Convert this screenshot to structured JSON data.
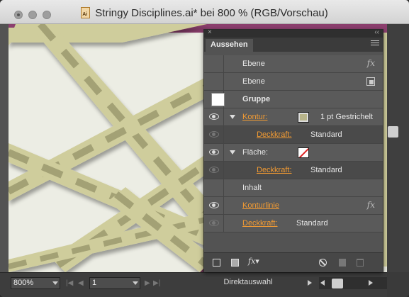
{
  "window": {
    "title": "Stringy Disciplines.ai* bei 800 % (RGB/Vorschau)",
    "file_icon_label": "Ai"
  },
  "panel": {
    "tab": "Aussehen",
    "rows": [
      {
        "id": "ebene1",
        "label": "Ebene",
        "icon": "fx-icon"
      },
      {
        "id": "ebene2",
        "label": "Ebene",
        "icon": "layer-target-icon"
      },
      {
        "id": "gruppe",
        "label": "Gruppe"
      },
      {
        "id": "kontur",
        "label": "Kontur:",
        "value": "1 pt Gestrichelt",
        "swatch": "#b8b48a"
      },
      {
        "id": "kontur-deckkraft",
        "label": "Deckkraft:",
        "value": "Standard"
      },
      {
        "id": "flaeche",
        "label": "Fläche:",
        "swatch": "none"
      },
      {
        "id": "flaeche-deckkraft",
        "label": "Deckkraft:",
        "value": "Standard"
      },
      {
        "id": "inhalt",
        "label": "Inhalt"
      },
      {
        "id": "konturlinie",
        "label": "Konturlinie"
      },
      {
        "id": "deckkraft",
        "label": "Deckkraft:",
        "value": "Standard"
      }
    ],
    "fx_label": "fx"
  },
  "statusbar": {
    "zoom": "800%",
    "page": "1",
    "tool": "Direktauswahl"
  },
  "colors": {
    "accent_link": "#f29b33",
    "canvas": "#ecede4",
    "stripe_fill": "#cfcd9c",
    "stripe_dash": "#a3a175",
    "magenta_band": "#8c3f6e"
  }
}
